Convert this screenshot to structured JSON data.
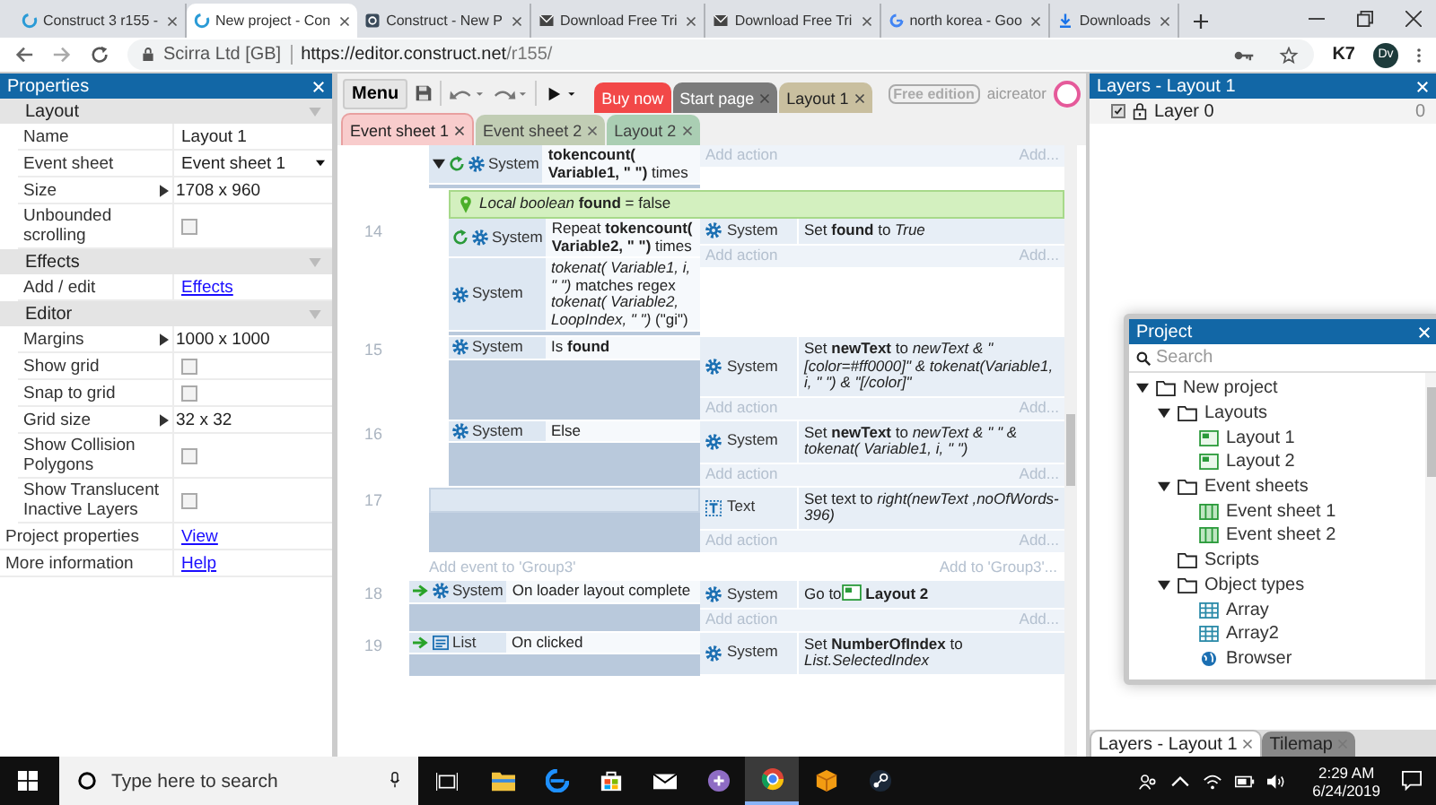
{
  "browser": {
    "tabs": [
      {
        "title": "Construct 3 r155 -",
        "kind": "construct",
        "selected": false
      },
      {
        "title": "New project - Con",
        "kind": "construct",
        "selected": true
      },
      {
        "title": "Construct - New P",
        "kind": "square",
        "selected": false
      },
      {
        "title": "Download Free Tri",
        "kind": "envelope",
        "selected": false
      },
      {
        "title": "Download Free Tri",
        "kind": "envelope",
        "selected": false
      },
      {
        "title": "north korea - Goo",
        "kind": "google",
        "selected": false
      },
      {
        "title": "Downloads",
        "kind": "download",
        "selected": false
      }
    ],
    "site_info": "Scirra Ltd [GB]",
    "url_host": "https://editor.construct.net",
    "url_path": "/r155/",
    "extension": "K7",
    "profile": "Dv"
  },
  "toolbar": {
    "menu": "Menu",
    "buy": "Buy now",
    "doc_tabs": [
      {
        "label": "Start page",
        "color": "#7b7b7b"
      },
      {
        "label": "Layout 1",
        "color": "#c9bf9f"
      }
    ],
    "edition": "Free edition",
    "user": "aicreator"
  },
  "sheet_tabs": [
    {
      "label": "Event sheet 1",
      "color": "#f8cccc",
      "selected": true
    },
    {
      "label": "Event sheet 2",
      "color": "#b9c7aa",
      "selected": false
    },
    {
      "label": "Layout 2",
      "color": "#9ec9a9",
      "selected": false
    }
  ],
  "properties": {
    "title": "Properties",
    "sections": [
      {
        "title": "Layout",
        "rows": [
          {
            "label": "Name",
            "kind": "text",
            "value": "Layout 1"
          },
          {
            "label": "Event sheet",
            "kind": "dropdown",
            "value": "Event sheet 1"
          },
          {
            "label": "Size",
            "kind": "expand",
            "value": "1708 x 960"
          },
          {
            "label": "Unbounded scrolling",
            "kind": "checkbox",
            "checked": false
          }
        ]
      },
      {
        "title": "Effects",
        "rows": [
          {
            "label": "Add / edit",
            "kind": "link",
            "value": "Effects"
          }
        ]
      },
      {
        "title": "Editor",
        "rows": [
          {
            "label": "Margins",
            "kind": "expand",
            "value": "1000 x 1000"
          },
          {
            "label": "Show grid",
            "kind": "checkbox",
            "checked": false
          },
          {
            "label": "Snap to grid",
            "kind": "checkbox",
            "checked": false
          },
          {
            "label": "Grid size",
            "kind": "expand",
            "value": "32 x 32"
          },
          {
            "label": "Show Collision Polygons",
            "kind": "checkbox",
            "checked": false
          },
          {
            "label": "Show Translucent Inactive Layers",
            "kind": "checkbox",
            "checked": false
          }
        ]
      }
    ],
    "footer": [
      {
        "label": "Project properties",
        "value": "View"
      },
      {
        "label": "More information",
        "value": "Help"
      }
    ]
  },
  "sheet": {
    "items": [
      {
        "kind": "group",
        "children": [
          {
            "kind": "event",
            "trigger": false,
            "expanded": true,
            "conditions": [
              {
                "object": "System",
                "kind": "system",
                "loop": true,
                "text": "**tokencount( Variable1, \" \")** times"
              }
            ],
            "add_action": {
              "label": "Add action",
              "more": "Add..."
            },
            "children": [
              {
                "kind": "variable",
                "text": "*Local boolean* **found** = false"
              },
              {
                "kind": "event",
                "number": "14",
                "trigger": false,
                "conditions": [
                  {
                    "object": "System",
                    "kind": "system",
                    "loop": true,
                    "text": "Repeat **tokencount( Variable2, \" \")** times"
                  },
                  {
                    "object": "System",
                    "kind": "system",
                    "loop": false,
                    "text": "*tokenat( Variable1, i, \" \")* matches regex *tokenat( Variable2, LoopIndex, \" \")* (\"gi\")"
                  }
                ],
                "actions": [
                  {
                    "object": "System",
                    "kind": "system",
                    "text": "Set **found** to *True*"
                  }
                ],
                "add_action": {
                  "label": "Add action",
                  "more": "Add..."
                }
              },
              {
                "kind": "event",
                "number": "15",
                "trigger": false,
                "conditions": [
                  {
                    "object": "System",
                    "kind": "system",
                    "loop": false,
                    "text": "Is **found**"
                  }
                ],
                "actions": [
                  {
                    "object": "System",
                    "kind": "system",
                    "text": "Set **newText** to *newText & \" [color=#ff0000]\" & tokenat(Variable1, i, \" \") & \"[/color]\"*"
                  }
                ],
                "add_action": {
                  "label": "Add action",
                  "more": "Add..."
                }
              },
              {
                "kind": "event",
                "number": "16",
                "trigger": false,
                "conditions": [
                  {
                    "object": "System",
                    "kind": "system",
                    "loop": false,
                    "text": "Else"
                  }
                ],
                "actions": [
                  {
                    "object": "System",
                    "kind": "system",
                    "text": "Set **newText** to *newText & \" \" & tokenat( Variable1, i, \" \")*"
                  }
                ],
                "add_action": {
                  "label": "Add action",
                  "more": "Add..."
                }
              }
            ]
          },
          {
            "kind": "event",
            "number": "17",
            "trigger": false,
            "actions": [
              {
                "object": "Text",
                "kind": "text",
                "text": "Set text to *right(newText ,noOfWords-396)*"
              }
            ],
            "add_action": {
              "label": "Add action",
              "more": "Add..."
            }
          },
          {
            "kind": "add_event",
            "label": "Add event to 'Group3'",
            "more": "Add to 'Group3'..."
          }
        ]
      },
      {
        "kind": "event",
        "number": "18",
        "trigger": true,
        "conditions": [
          {
            "object": "System",
            "kind": "system",
            "loop": false,
            "text": "On loader layout complete"
          }
        ],
        "actions": [
          {
            "object": "System",
            "kind": "system",
            "text": "Go to",
            "target": "Layout 2"
          }
        ],
        "add_action": {
          "label": "Add action",
          "more": "Add..."
        }
      },
      {
        "kind": "event",
        "number": "19",
        "trigger": true,
        "conditions": [
          {
            "object": "List",
            "kind": "list",
            "loop": false,
            "text": "On clicked"
          }
        ],
        "actions": [
          {
            "object": "System",
            "kind": "system",
            "text": "Set **NumberOfIndex** to *List.SelectedIndex*"
          }
        ]
      }
    ]
  },
  "layers": {
    "title": "Layers - Layout 1",
    "items": [
      {
        "name": "Layer 0",
        "visible": true,
        "count": "0"
      }
    ]
  },
  "project": {
    "title": "Project",
    "search_placeholder": "Search",
    "tree": [
      {
        "label": "New project",
        "kind": "folder",
        "expanded": true,
        "children": [
          {
            "label": "Layouts",
            "kind": "folder",
            "expanded": true,
            "children": [
              {
                "label": "Layout 1",
                "kind": "layout"
              },
              {
                "label": "Layout 2",
                "kind": "layout"
              }
            ]
          },
          {
            "label": "Event sheets",
            "kind": "folder",
            "expanded": true,
            "children": [
              {
                "label": "Event sheet 1",
                "kind": "sheet"
              },
              {
                "label": "Event sheet 2",
                "kind": "sheet"
              }
            ]
          },
          {
            "label": "Scripts",
            "kind": "folder"
          },
          {
            "label": "Object types",
            "kind": "folder",
            "expanded": true,
            "children": [
              {
                "label": "Array",
                "kind": "array"
              },
              {
                "label": "Array2",
                "kind": "array"
              },
              {
                "label": "Browser",
                "kind": "browser"
              }
            ]
          }
        ]
      }
    ]
  },
  "bottom_tabs": [
    {
      "label": "Layers - Layout 1",
      "selected": true
    },
    {
      "label": "Tilemap",
      "selected": false
    }
  ],
  "taskbar": {
    "search_placeholder": "Type here to search",
    "apps": [
      {
        "kind": "explorer",
        "active": false
      },
      {
        "kind": "edge",
        "active": false
      },
      {
        "kind": "store",
        "active": false
      },
      {
        "kind": "mail",
        "active": false
      },
      {
        "kind": "torrent",
        "active": false
      },
      {
        "kind": "chrome",
        "active": true
      },
      {
        "kind": "box",
        "active": false
      },
      {
        "kind": "steam",
        "active": false
      }
    ],
    "time": "2:29 AM",
    "date": "6/24/2019"
  }
}
